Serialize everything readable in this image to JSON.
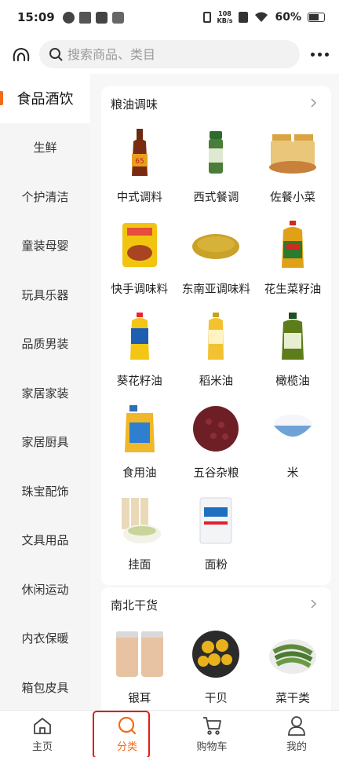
{
  "status_bar": {
    "time": "15:09",
    "net_speed_value": "108",
    "net_speed_unit": "KB/s",
    "battery": "60%"
  },
  "search": {
    "placeholder": "搜索商品、类目"
  },
  "sidebar": {
    "items": [
      {
        "label": "食品酒饮",
        "active": true
      },
      {
        "label": "生鲜"
      },
      {
        "label": "个护清洁"
      },
      {
        "label": "童装母婴"
      },
      {
        "label": "玩具乐器"
      },
      {
        "label": "品质男装"
      },
      {
        "label": "家居家装"
      },
      {
        "label": "家居厨具"
      },
      {
        "label": "珠宝配饰"
      },
      {
        "label": "文具用品"
      },
      {
        "label": "休闲运动"
      },
      {
        "label": "内衣保暖"
      },
      {
        "label": "箱包皮具"
      }
    ]
  },
  "sections": [
    {
      "title": "粮油调味",
      "items": [
        {
          "label": "中式调料",
          "icon": "soy-sauce-bottle-icon"
        },
        {
          "label": "西式餐调",
          "icon": "spice-jar-icon"
        },
        {
          "label": "佐餐小菜",
          "icon": "pickle-jars-icon"
        },
        {
          "label": "快手调味料",
          "icon": "seasoning-pack-icon"
        },
        {
          "label": "东南亚调味料",
          "icon": "curry-powder-icon"
        },
        {
          "label": "花生菜籽油",
          "icon": "peanut-oil-icon"
        },
        {
          "label": "葵花籽油",
          "icon": "sunflower-oil-icon"
        },
        {
          "label": "稻米油",
          "icon": "rice-bran-oil-icon"
        },
        {
          "label": "橄榄油",
          "icon": "olive-oil-icon"
        },
        {
          "label": "食用油",
          "icon": "cooking-oil-icon"
        },
        {
          "label": "五谷杂粮",
          "icon": "red-beans-icon"
        },
        {
          "label": "米",
          "icon": "rice-bowl-icon"
        },
        {
          "label": "挂面",
          "icon": "noodles-icon"
        },
        {
          "label": "面粉",
          "icon": "flour-bag-icon"
        }
      ]
    },
    {
      "title": "南北干货",
      "items": [
        {
          "label": "银耳",
          "icon": "white-fungus-jars-icon"
        },
        {
          "label": "干贝",
          "icon": "dried-scallop-icon"
        },
        {
          "label": "菜干类",
          "icon": "dried-vegetable-icon"
        }
      ]
    }
  ],
  "tabbar": {
    "items": [
      {
        "label": "主页",
        "icon": "home-icon"
      },
      {
        "label": "分类",
        "icon": "search-icon",
        "active": true
      },
      {
        "label": "购物车",
        "icon": "cart-icon"
      },
      {
        "label": "我的",
        "icon": "user-icon"
      }
    ]
  },
  "colors": {
    "accent": "#f26a1b",
    "highlight_box": "#e21b1b"
  }
}
